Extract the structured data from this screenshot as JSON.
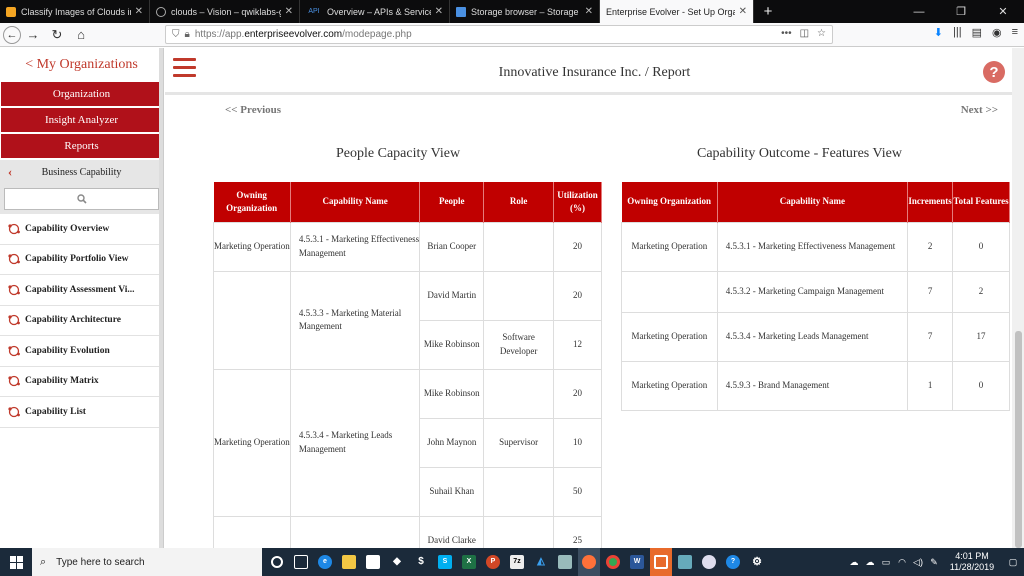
{
  "browser": {
    "tabs": [
      {
        "label": "Classify Images of Clouds in the",
        "favicon": "q"
      },
      {
        "label": "clouds – Vision – qwiklabs-gcp",
        "favicon": "g"
      },
      {
        "label": "Overview – APIs & Services – q",
        "favicon": "API"
      },
      {
        "label": "Storage browser – Storage – q",
        "favicon": "s"
      },
      {
        "label": "Enterprise Evolver - Set Up Organiz",
        "favicon": ""
      }
    ],
    "url": {
      "protocol": "https://app.",
      "domain": "enterpriseevolver.com",
      "path": "/modepage.php"
    }
  },
  "sidebar": {
    "back_label": "< My Organizations",
    "buttons": [
      "Organization",
      "Insight Analyzer",
      "Reports"
    ],
    "section_label": "Business Capability",
    "items": [
      "Capability Overview",
      "Capability Portfolio View",
      "Capability Assessment Vi...",
      "Capability Architecture",
      "Capability Evolution",
      "Capability Matrix",
      "Capability List"
    ]
  },
  "header": {
    "title": "Innovative Insurance Inc. / Report",
    "help_glyph": "?"
  },
  "pager": {
    "prev": "<< Previous",
    "next": "Next >>"
  },
  "people_view": {
    "title": "People Capacity View",
    "columns": [
      "Owning Organization",
      "Capability Name",
      "People",
      "Role",
      "Utilization (%)"
    ],
    "rows": [
      {
        "org": "Marketing Operation",
        "cap": "4.5.3.1 - Marketing Effectiveness Management",
        "person": "Brian Cooper",
        "role": "",
        "util": "20"
      },
      {
        "org": "",
        "cap": "4.5.3.3 - Marketing Material Mangement",
        "person": "David Martin",
        "role": "",
        "util": "20"
      },
      {
        "person": "Mike Robinson",
        "role": "Software Developer",
        "util": "12"
      },
      {
        "org": "Marketing Operation",
        "cap": "4.5.3.4 - Marketing Leads Management",
        "person": "Mike Robinson",
        "role": "",
        "util": "20"
      },
      {
        "person": "John Maynon",
        "role": "Supervisor",
        "util": "10"
      },
      {
        "person": "Suhail Khan",
        "role": "",
        "util": "50"
      },
      {
        "org": "",
        "cap": "",
        "person": "David Clarke",
        "role": "",
        "util": "25"
      }
    ]
  },
  "features_view": {
    "title": "Capability Outcome - Features View",
    "columns": [
      "Owning Organization",
      "Capability Name",
      "Increments",
      "Total Features"
    ],
    "rows": [
      {
        "org": "Marketing Operation",
        "cap": "4.5.3.1 - Marketing Effectiveness Management",
        "inc": "2",
        "total": "0"
      },
      {
        "org": "",
        "cap": "4.5.3.2 - Marketing Campaign Management",
        "inc": "7",
        "total": "2"
      },
      {
        "org": "Marketing Operation",
        "cap": "4.5.3.4 - Marketing Leads Management",
        "inc": "7",
        "total": "17"
      },
      {
        "org": "Marketing Operation",
        "cap": "4.5.9.3 - Brand Management",
        "inc": "1",
        "total": "0"
      }
    ]
  },
  "taskbar": {
    "search_placeholder": "Type here to search",
    "time": "4:01 PM",
    "date": "11/28/2019"
  },
  "colors": {
    "brand_red": "#c00000",
    "sidebar_red": "#b0111a",
    "link_red": "#c0392b"
  }
}
